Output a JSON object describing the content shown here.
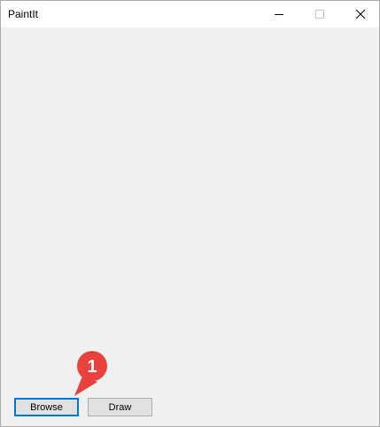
{
  "window": {
    "title": "PaintIt",
    "controls": {
      "minimize_icon": "minimize-icon",
      "maximize_icon": "maximize-icon",
      "close_icon": "close-icon"
    }
  },
  "buttons": {
    "browse_label": "Browse",
    "draw_label": "Draw"
  },
  "annotation": {
    "step_number": "1",
    "color": "#e8423f"
  },
  "colors": {
    "accent": "#0078d7",
    "client_background": "#f0f0f0",
    "button_face": "#e1e1e1"
  }
}
